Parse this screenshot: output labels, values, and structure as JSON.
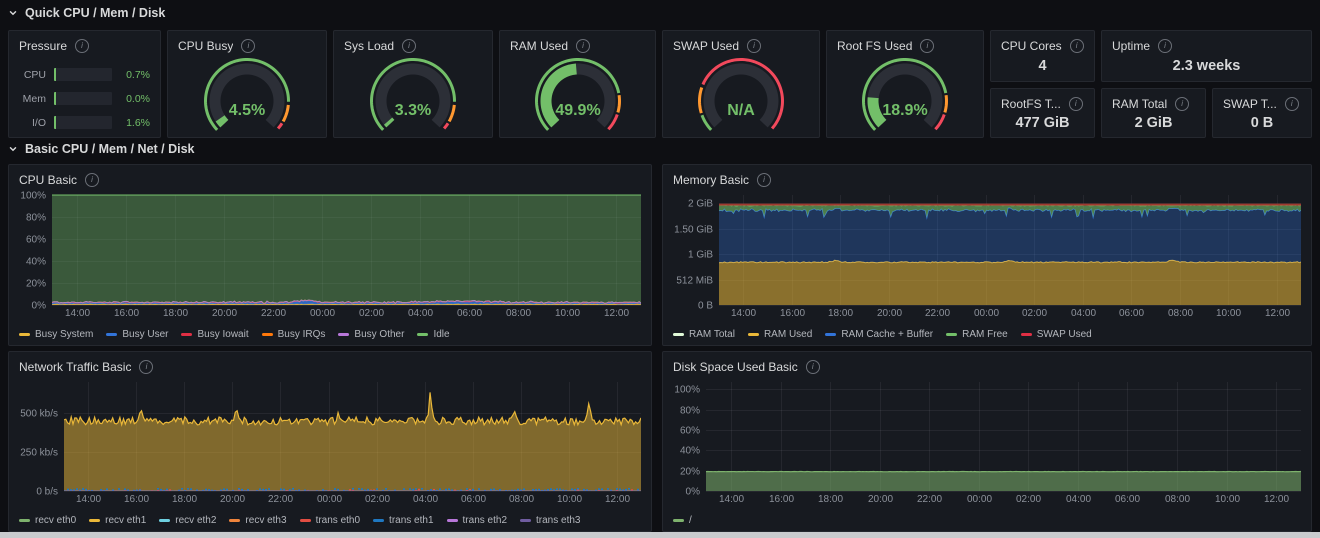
{
  "colors": {
    "bg": "#0E0F13",
    "panel": "#171A20",
    "panel_border": "#25282F",
    "text": "#D8D9DA",
    "muted": "#8D929B",
    "grid": "rgba(204,204,220,0.08)",
    "green": "#73BF69",
    "yellow": "#EAB839",
    "orange": "#FF9830",
    "red": "#F2495C"
  },
  "sections": [
    {
      "title": "Quick CPU / Mem / Disk"
    },
    {
      "title": "Basic CPU / Mem / Net / Disk"
    }
  ],
  "pressure": {
    "title": "Pressure",
    "rows": [
      {
        "label": "CPU",
        "value": "0.7%",
        "pct": 0.7
      },
      {
        "label": "Mem",
        "value": "0.0%",
        "pct": 0.0
      },
      {
        "label": "I/O",
        "value": "1.6%",
        "pct": 1.6
      }
    ]
  },
  "gauges": [
    {
      "title": "CPU Busy",
      "value": "4.5%",
      "pct": 4.5,
      "thresholds": [
        {
          "to": 85,
          "color": "#73BF69"
        },
        {
          "to": 95,
          "color": "#FF9830"
        },
        {
          "to": 100,
          "color": "#F2495C"
        }
      ]
    },
    {
      "title": "Sys Load",
      "value": "3.3%",
      "pct": 3.3,
      "thresholds": [
        {
          "to": 85,
          "color": "#73BF69"
        },
        {
          "to": 95,
          "color": "#FF9830"
        },
        {
          "to": 100,
          "color": "#F2495C"
        }
      ]
    },
    {
      "title": "RAM Used",
      "value": "49.9%",
      "pct": 49.9,
      "thresholds": [
        {
          "to": 80,
          "color": "#73BF69"
        },
        {
          "to": 90,
          "color": "#FF9830"
        },
        {
          "to": 100,
          "color": "#F2495C"
        }
      ]
    },
    {
      "title": "SWAP Used",
      "value": "N/A",
      "pct": 0,
      "thresholds": [
        {
          "to": 10,
          "color": "#73BF69"
        },
        {
          "to": 25,
          "color": "#FF9830"
        },
        {
          "to": 100,
          "color": "#F2495C"
        }
      ]
    },
    {
      "title": "Root FS Used",
      "value": "18.9%",
      "pct": 18.9,
      "thresholds": [
        {
          "to": 80,
          "color": "#73BF69"
        },
        {
          "to": 90,
          "color": "#FF9830"
        },
        {
          "to": 100,
          "color": "#F2495C"
        }
      ]
    }
  ],
  "stats": [
    {
      "title": "CPU Cores",
      "value": "4"
    },
    {
      "title": "Uptime",
      "value": "2.3 weeks"
    },
    {
      "title": "RootFS T...",
      "value": "477 GiB"
    },
    {
      "title": "RAM Total",
      "value": "2 GiB"
    },
    {
      "title": "SWAP T...",
      "value": "0 B"
    }
  ],
  "chart_data": [
    {
      "type": "area",
      "title": "CPU Basic",
      "stacked": true,
      "unit": "percent",
      "y_max": 100,
      "grid": true,
      "legend_position": "bottom",
      "y_ticks": [
        {
          "v": 0,
          "label": "0%"
        },
        {
          "v": 20,
          "label": "20%"
        },
        {
          "v": 40,
          "label": "40%"
        },
        {
          "v": 60,
          "label": "60%"
        },
        {
          "v": 80,
          "label": "80%"
        },
        {
          "v": 100,
          "label": "100%"
        }
      ],
      "x_ticks": [
        "14:00",
        "16:00",
        "18:00",
        "20:00",
        "22:00",
        "00:00",
        "02:00",
        "04:00",
        "06:00",
        "08:00",
        "10:00",
        "12:00"
      ],
      "series": [
        {
          "name": "Busy System",
          "color": "#EAB839",
          "style": "area",
          "base": 0.8,
          "noise": 0.3,
          "alpha": 0.85
        },
        {
          "name": "Busy User",
          "color": "#3274D9",
          "style": "area",
          "base": 1.0,
          "noise": 0.5,
          "alpha": 0.85,
          "bumps": [
            {
              "f": 0.43,
              "h": 1.8,
              "w": 0.02
            },
            {
              "f": 0.7,
              "h": 1.0,
              "w": 0.07
            }
          ]
        },
        {
          "name": "Busy Iowait",
          "color": "#E02F44",
          "style": "area",
          "base": 0.6,
          "noise": 0.4,
          "alpha": 0.85
        },
        {
          "name": "Busy IRQs",
          "color": "#FF780A",
          "style": "area",
          "base": 0.05,
          "noise": 0.05,
          "alpha": 0.85
        },
        {
          "name": "Busy Other",
          "color": "#B877D9",
          "style": "area",
          "base": 0.05,
          "noise": 0.05,
          "alpha": 0.85
        },
        {
          "name": "Idle",
          "color": "#73BF69",
          "style": "area-rest",
          "alpha": 0.38
        }
      ]
    },
    {
      "type": "area",
      "title": "Memory Basic",
      "stacked": true,
      "unit": "GiB",
      "y_max": 2.16,
      "grid": true,
      "legend_position": "bottom",
      "y_ticks": [
        {
          "v": 0,
          "label": "0 B"
        },
        {
          "v": 0.5,
          "label": "512 MiB"
        },
        {
          "v": 1,
          "label": "1 GiB"
        },
        {
          "v": 1.5,
          "label": "1.50 GiB"
        },
        {
          "v": 2,
          "label": "2 GiB"
        }
      ],
      "x_ticks": [
        "14:00",
        "16:00",
        "18:00",
        "20:00",
        "22:00",
        "00:00",
        "02:00",
        "04:00",
        "06:00",
        "08:00",
        "10:00",
        "12:00"
      ],
      "series": [
        {
          "name": "RAM Total",
          "color": "#E0F9D7",
          "line_color": "#A0392F",
          "style": "line",
          "value": 1.97,
          "width": 2
        },
        {
          "name": "RAM Used",
          "color": "#EAB839",
          "style": "area",
          "base": 0.84,
          "noise": 0.012,
          "alpha": 0.55,
          "bumps": [
            {
              "f": 0.2,
              "h": 0.03,
              "w": 0.01
            },
            {
              "f": 0.5,
              "h": 0.04,
              "w": 0.008
            },
            {
              "f": 0.78,
              "h": 0.03,
              "w": 0.01
            }
          ]
        },
        {
          "name": "RAM Cache + Buffer",
          "color": "#3274D9",
          "style": "area",
          "base": 1.02,
          "noise": 0.02,
          "alpha": 0.32,
          "stroke_width": 0.8,
          "dip_chance": 0.05,
          "dip": 0.12
        },
        {
          "name": "RAM Free",
          "color": "#73BF69",
          "style": "area-cap",
          "top": 1.955,
          "noise": 0.01,
          "alpha": 0.6
        },
        {
          "name": "SWAP Used",
          "color": "#E02F44",
          "style": "line",
          "value": 0,
          "width": 0
        }
      ]
    },
    {
      "type": "area",
      "title": "Network Traffic Basic",
      "stacked": false,
      "unit": "kb/s",
      "y_max": 700,
      "grid": true,
      "legend_position": "bottom",
      "y_ticks": [
        {
          "v": 0,
          "label": "0 b/s"
        },
        {
          "v": 250,
          "label": "250 kb/s"
        },
        {
          "v": 500,
          "label": "500 kb/s"
        }
      ],
      "x_ticks": [
        "14:00",
        "16:00",
        "18:00",
        "20:00",
        "22:00",
        "00:00",
        "02:00",
        "04:00",
        "06:00",
        "08:00",
        "10:00",
        "12:00"
      ],
      "series": [
        {
          "name": "recv eth0",
          "color": "#7EB26D",
          "style": "line",
          "value": 1,
          "width": 1
        },
        {
          "name": "recv eth1",
          "color": "#EAB839",
          "style": "area",
          "base": 450,
          "noise": 26,
          "alpha": 0.5,
          "stroke_width": 1.2,
          "spikes": [
            {
              "f": 0.135,
              "h": 60,
              "w": 0.004
            },
            {
              "f": 0.3,
              "h": 70,
              "w": 0.004
            },
            {
              "f": 0.475,
              "h": 70,
              "w": 0.003
            },
            {
              "f": 0.635,
              "h": 175,
              "w": 0.003
            },
            {
              "f": 0.78,
              "h": 55,
              "w": 0.003
            },
            {
              "f": 0.91,
              "h": 115,
              "w": 0.003
            }
          ]
        },
        {
          "name": "recv eth2",
          "color": "#6ED0E0",
          "style": "line",
          "value": 0,
          "width": 0.8
        },
        {
          "name": "recv eth3",
          "color": "#EF843C",
          "style": "line",
          "value": 0,
          "width": 0.8
        },
        {
          "name": "trans eth0",
          "color": "#E24D42",
          "style": "dots",
          "value": 5,
          "density": 0.3
        },
        {
          "name": "trans eth1",
          "color": "#1F78C1",
          "style": "dots",
          "value": 10,
          "density": 0.85
        },
        {
          "name": "trans eth2",
          "color": "#B877D9",
          "style": "line",
          "value": 0,
          "width": 0.8
        },
        {
          "name": "trans eth3",
          "color": "#705DA0",
          "style": "line",
          "value": 0,
          "width": 0.8
        }
      ]
    },
    {
      "type": "area",
      "title": "Disk Space Used Basic",
      "stacked": false,
      "unit": "percent",
      "y_max": 107,
      "grid": true,
      "legend_position": "bottom",
      "y_ticks": [
        {
          "v": 0,
          "label": "0%"
        },
        {
          "v": 20,
          "label": "20%"
        },
        {
          "v": 40,
          "label": "40%"
        },
        {
          "v": 60,
          "label": "60%"
        },
        {
          "v": 80,
          "label": "80%"
        },
        {
          "v": 100,
          "label": "100%"
        }
      ],
      "x_ticks": [
        "14:00",
        "16:00",
        "18:00",
        "20:00",
        "22:00",
        "00:00",
        "02:00",
        "04:00",
        "06:00",
        "08:00",
        "10:00",
        "12:00"
      ],
      "series": [
        {
          "name": "/",
          "color": "#7EB26D",
          "style": "area",
          "base": 19,
          "noise": 0.15,
          "alpha": 0.55,
          "stroke_width": 1.2
        }
      ]
    }
  ]
}
